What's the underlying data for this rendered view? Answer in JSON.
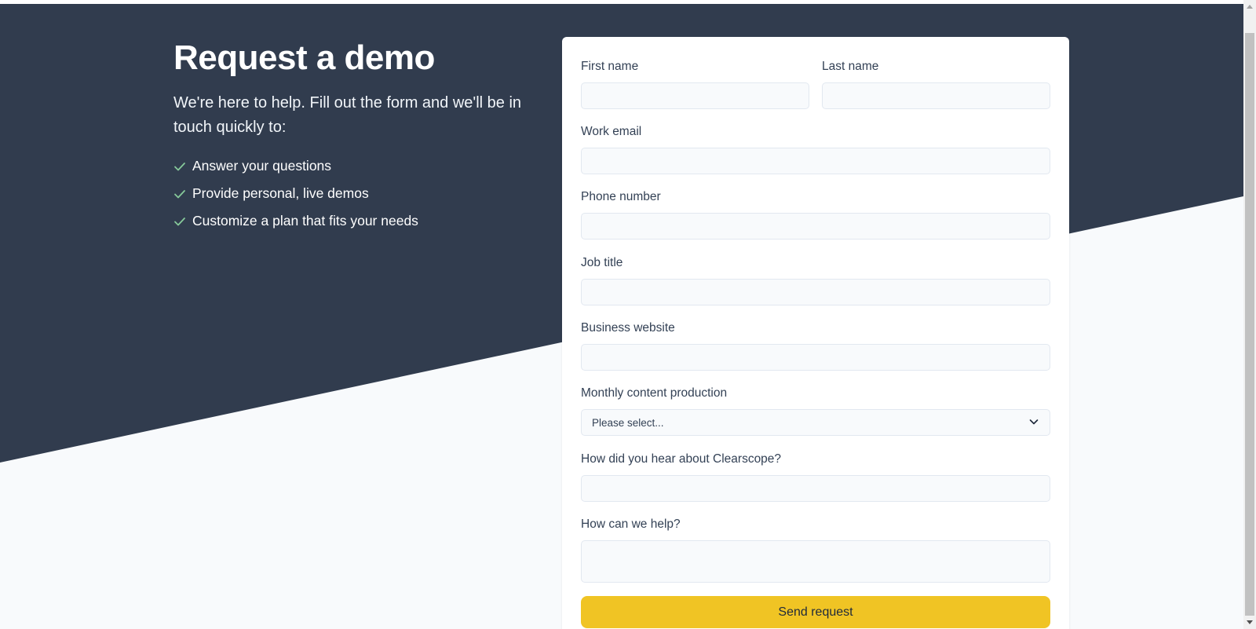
{
  "hero": {
    "title": "Request a demo",
    "intro": "We're here to help. Fill out the form and we'll be in touch quickly to:",
    "benefits": [
      "Answer your questions",
      "Provide personal, live demos",
      "Customize a plan that fits your needs"
    ]
  },
  "form": {
    "first_name_label": "First name",
    "last_name_label": "Last name",
    "work_email_label": "Work email",
    "phone_label": "Phone number",
    "job_title_label": "Job title",
    "website_label": "Business website",
    "monthly_label": "Monthly content production",
    "monthly_selected": "Please select...",
    "hear_label": "How did you hear about Clearscope?",
    "help_label": "How can we help?",
    "submit_label": "Send request"
  },
  "colors": {
    "dark_bg": "#313c4e",
    "light_bg": "#f8fafc",
    "accent_button": "#f0c424",
    "check": "#86c99a"
  },
  "icons": {
    "check": "check-icon",
    "select_caret": "chevron-down-icon"
  }
}
